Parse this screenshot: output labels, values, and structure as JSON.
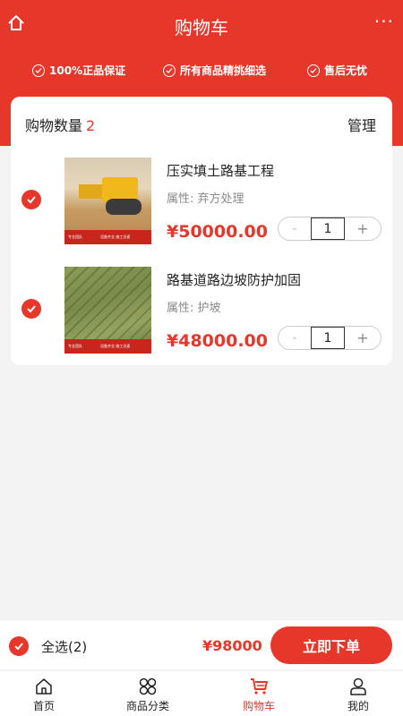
{
  "topbar": {
    "title": "购物车",
    "more": "···"
  },
  "guarantees": [
    "100%正品保证",
    "所有商品精挑细选",
    "售后无忧"
  ],
  "cart": {
    "count_label": "购物数量",
    "count": "2",
    "manage": "管理"
  },
  "items": [
    {
      "name": "压实填土路基工程",
      "attr": "属性: 弃方处理",
      "price": "¥50000.00",
      "minus": "-",
      "qty": "1",
      "plus": "+",
      "strip_left": "专业团队",
      "strip_right": "设备齐全 施工迅速"
    },
    {
      "name": "路基道路边坡防护加固",
      "attr": "属性: 护坡",
      "price": "¥48000.00",
      "minus": "-",
      "qty": "1",
      "plus": "+",
      "strip_left": "专业团队",
      "strip_right": "设备齐全 施工迅速"
    }
  ],
  "checkout": {
    "select_all": "全选(2)",
    "total": "¥98000",
    "order_button": "立即下单"
  },
  "tabbar": [
    {
      "label": "首页",
      "icon": "home-icon"
    },
    {
      "label": "商品分类",
      "icon": "category-icon"
    },
    {
      "label": "购物车",
      "icon": "cart-icon",
      "active": true
    },
    {
      "label": "我的",
      "icon": "user-icon"
    }
  ],
  "colors": {
    "accent": "#e6372a",
    "background": "#f3f3f3"
  }
}
